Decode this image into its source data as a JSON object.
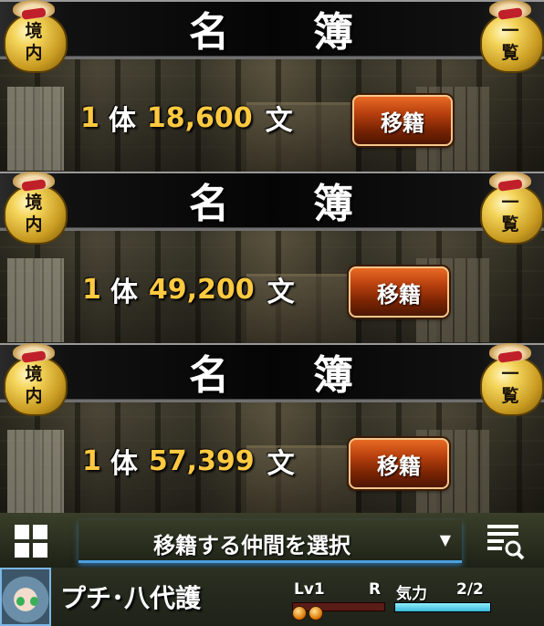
{
  "panels": [
    {
      "title_left": "名",
      "title_right": "簿",
      "bag_left": [
        "境",
        "内"
      ],
      "bag_right": [
        "一",
        "覧"
      ],
      "count": "1",
      "count_unit": "体",
      "amount": "18,600",
      "currency": "文",
      "button_label": "移籍"
    },
    {
      "title_left": "名",
      "title_right": "簿",
      "bag_left": [
        "境",
        "内"
      ],
      "bag_right": [
        "一",
        "覧"
      ],
      "count": "1",
      "count_unit": "体",
      "amount": "49,200",
      "currency": "文",
      "button_label": "移籍"
    },
    {
      "title_left": "名",
      "title_right": "簿",
      "bag_left": [
        "境",
        "内"
      ],
      "bag_right": [
        "一",
        "覧"
      ],
      "count": "1",
      "count_unit": "体",
      "amount": "57,399",
      "currency": "文",
      "button_label": "移籍"
    }
  ],
  "toolbar": {
    "select_label": "移籍する仲間を選択",
    "select_arrow": "▼",
    "grid_icon": "grid-icon",
    "search_icon": "list-search-icon"
  },
  "member": {
    "name": "プチ･八代護",
    "level": "Lv1",
    "rank": "R",
    "stamina_label": "気力",
    "stamina_value": "2/2",
    "stamina_fraction": 1.0,
    "orbs": 2
  },
  "colors": {
    "gold_text": "#ffc940",
    "button": "#b8400e",
    "accent_blue": "#4a9fe0"
  }
}
